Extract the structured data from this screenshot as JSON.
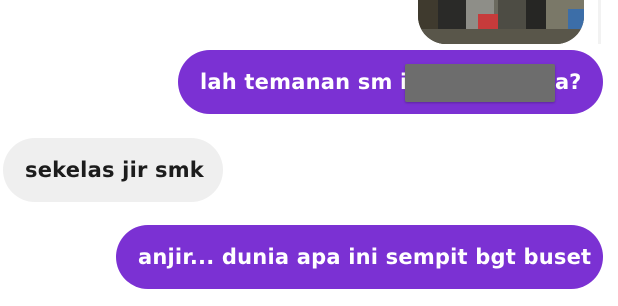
{
  "messages": [
    {
      "direction": "sent",
      "text_visible_start": "lah temanan sm il",
      "text_visible_end": "a?",
      "redacted": true
    },
    {
      "direction": "received",
      "text": "sekelas jir smk"
    },
    {
      "direction": "sent",
      "text": "anjir... dunia apa ini sempit bgt buset"
    }
  ],
  "colors": {
    "sent_bubble": "#7b31d3",
    "received_bubble": "#efefef",
    "background": "#ffffff",
    "redaction": "#6d6d6d"
  }
}
